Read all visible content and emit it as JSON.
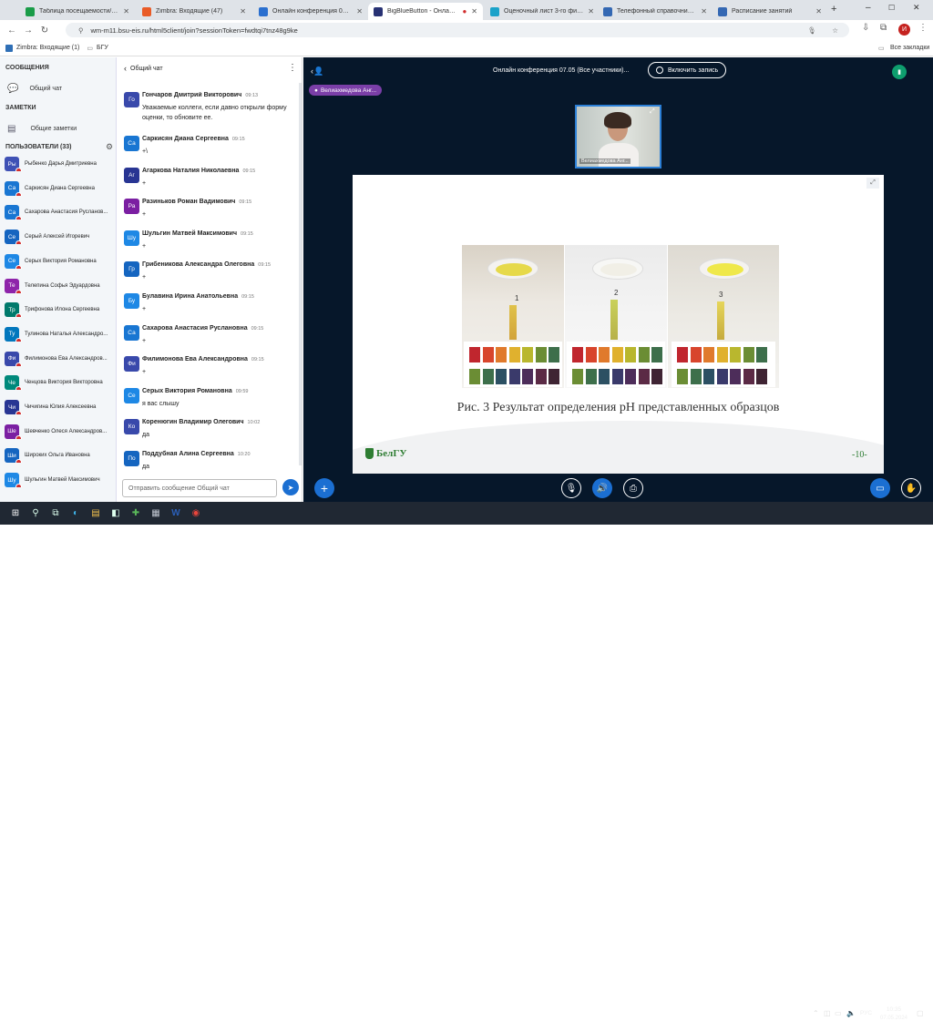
{
  "browser": {
    "tabs": [
      {
        "label": "Таблица посещаемости/успе",
        "color": "#1a9c48"
      },
      {
        "label": "Zimbra: Входящие (47)",
        "color": "#e95b26"
      },
      {
        "label": "Онлайн конференция 07.05",
        "color": "#2a6fcf"
      },
      {
        "label": "BigBlueButton - Онлайн ко",
        "color": "#283274"
      },
      {
        "label": "Оценочный лист 3-го финал",
        "color": "#1aa2c9"
      },
      {
        "label": "Телефонный справочник НИ",
        "color": "#3468b3"
      },
      {
        "label": "Расписание занятий",
        "color": "#3468b3"
      }
    ],
    "url": "wm-m11.bsu-eis.ru/html5client/join?sessionToken=fwdtqi7tnz48g9ke",
    "bookmarks": [
      "Zimbra: Входящие (1)",
      "БГУ"
    ],
    "all_bookmarks": "Все закладки",
    "profile_initial": "И"
  },
  "sidebar": {
    "messages_header": "СООБЩЕНИЯ",
    "public_chat": "Общий чат",
    "notes_header": "ЗАМЕТКИ",
    "shared_notes": "Общие заметки",
    "users_header": "ПОЛЬЗОВАТЕЛИ (33)",
    "users": [
      {
        "initials": "Ры",
        "name": "Рыбенко Дарья Дмитриевна",
        "color": "#3f51b5"
      },
      {
        "initials": "Са",
        "name": "Саркисян Диана Сергеевна",
        "color": "#1976d2"
      },
      {
        "initials": "Са",
        "name": "Сахарова Анастасия Русланов...",
        "color": "#1976d2"
      },
      {
        "initials": "Се",
        "name": "Серый Алексей Игоревич",
        "color": "#1565c0"
      },
      {
        "initials": "Се",
        "name": "Серых Виктория Романовна",
        "color": "#1e88e5"
      },
      {
        "initials": "Те",
        "name": "Телепина Софья Эдуардовна",
        "color": "#8e24aa"
      },
      {
        "initials": "Тр",
        "name": "Трифонова Илона Сергеевна",
        "color": "#00796b"
      },
      {
        "initials": "Ту",
        "name": "Тулинова Наталья Александро...",
        "color": "#0277bd"
      },
      {
        "initials": "Фи",
        "name": "Филимонова Ева Александров...",
        "color": "#3949ab"
      },
      {
        "initials": "Че",
        "name": "Ченцова Виктория Викторовна",
        "color": "#00897b"
      },
      {
        "initials": "Чи",
        "name": "Чичигина Юлия Алексеевна",
        "color": "#283593"
      },
      {
        "initials": "Ше",
        "name": "Шевченко Олеся Александров...",
        "color": "#7b1fa2"
      },
      {
        "initials": "Ши",
        "name": "Широких Ольга Ивановна",
        "color": "#1565c0"
      },
      {
        "initials": "Шу",
        "name": "Шульгин Матвей Максимович",
        "color": "#1e88e5"
      }
    ]
  },
  "chat": {
    "title": "Общий чат",
    "messages": [
      {
        "initials": "Го",
        "name": "Гончаров Дмитрий Викторович",
        "time": "09:13",
        "text": "Уважаемые коллеги, если давно открыли форму оценки, то обновите ее.",
        "color": "#3949ab"
      },
      {
        "initials": "Са",
        "name": "Саркисян Диана Сергеевна",
        "time": "09:15",
        "text": "+\\",
        "color": "#1976d2"
      },
      {
        "initials": "Аг",
        "name": "Агаркова Наталия Николаевна",
        "time": "09:15",
        "text": "+",
        "color": "#283593"
      },
      {
        "initials": "Ра",
        "name": "Разиньков Роман Вадимович",
        "time": "09:15",
        "text": "+",
        "color": "#7b1fa2"
      },
      {
        "initials": "Шу",
        "name": "Шульгин Матвей Максимович",
        "time": "09:15",
        "text": "+",
        "color": "#1e88e5"
      },
      {
        "initials": "Гр",
        "name": "Грибеникова Александра Олеговна",
        "time": "09:15",
        "text": "+",
        "color": "#1565c0"
      },
      {
        "initials": "Бу",
        "name": "Булавина Ирина Анатольевна",
        "time": "09:15",
        "text": "+",
        "color": "#1e88e5"
      },
      {
        "initials": "Са",
        "name": "Сахарова Анастасия Руслановна",
        "time": "09:15",
        "text": "+",
        "color": "#1976d2"
      },
      {
        "initials": "Фи",
        "name": "Филимонова Ева Александровна",
        "time": "09:15",
        "text": "+",
        "color": "#3949ab"
      },
      {
        "initials": "Се",
        "name": "Серых Виктория Романовна",
        "time": "09:59",
        "text": "я вас слышу",
        "color": "#1e88e5"
      },
      {
        "initials": "Ко",
        "name": "Коренюгин Владимир Олегович",
        "time": "10:02",
        "text": "да",
        "color": "#3949ab"
      },
      {
        "initials": "По",
        "name": "Поддубная Алина Сергеевна",
        "time": "10:20",
        "text": "да",
        "color": "#1565c0"
      }
    ],
    "input_placeholder": "Отправить сообщение Общий чат"
  },
  "main": {
    "meeting_title": "Онлайн конференция 07.05 (Все участники)...",
    "record_label": "Включить запись",
    "presenter_badge": "Велиахмедова Анг...",
    "webcam_label": "Велиахмедова Анг...",
    "slide_caption": "Рис. 3 Результат определения pH представленных образцов",
    "slide_number": "-10-",
    "logo_text": "БелГУ",
    "sample_labels": [
      "1",
      "2",
      "3"
    ]
  },
  "taskbar": {
    "time": "10:35",
    "date": "07.05.2024",
    "lang": "РУС"
  }
}
